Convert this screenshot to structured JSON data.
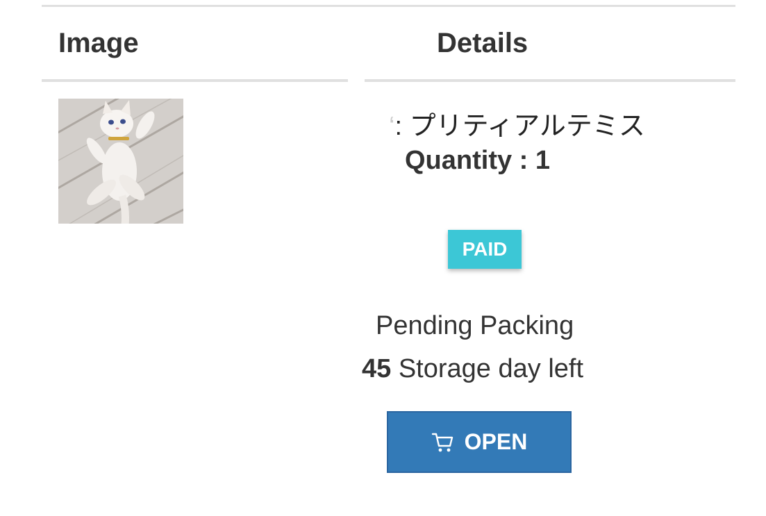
{
  "table": {
    "headers": {
      "image": "Image",
      "details": "Details"
    }
  },
  "item": {
    "name_prefix": "‘",
    "name": ": プリティアルテミス",
    "quantity_label": "Quantity",
    "quantity_sep": " : ",
    "quantity_value": "1",
    "payment_status": "PAID",
    "state": "Pending Packing",
    "storage_days": "45",
    "storage_suffix": " Storage day left",
    "open_button_label": "OPEN",
    "open_button_icon": "cart-icon"
  },
  "colors": {
    "badge_bg": "#3cc7d6",
    "button_bg": "#337ab7",
    "rule": "#e0e0e0"
  }
}
